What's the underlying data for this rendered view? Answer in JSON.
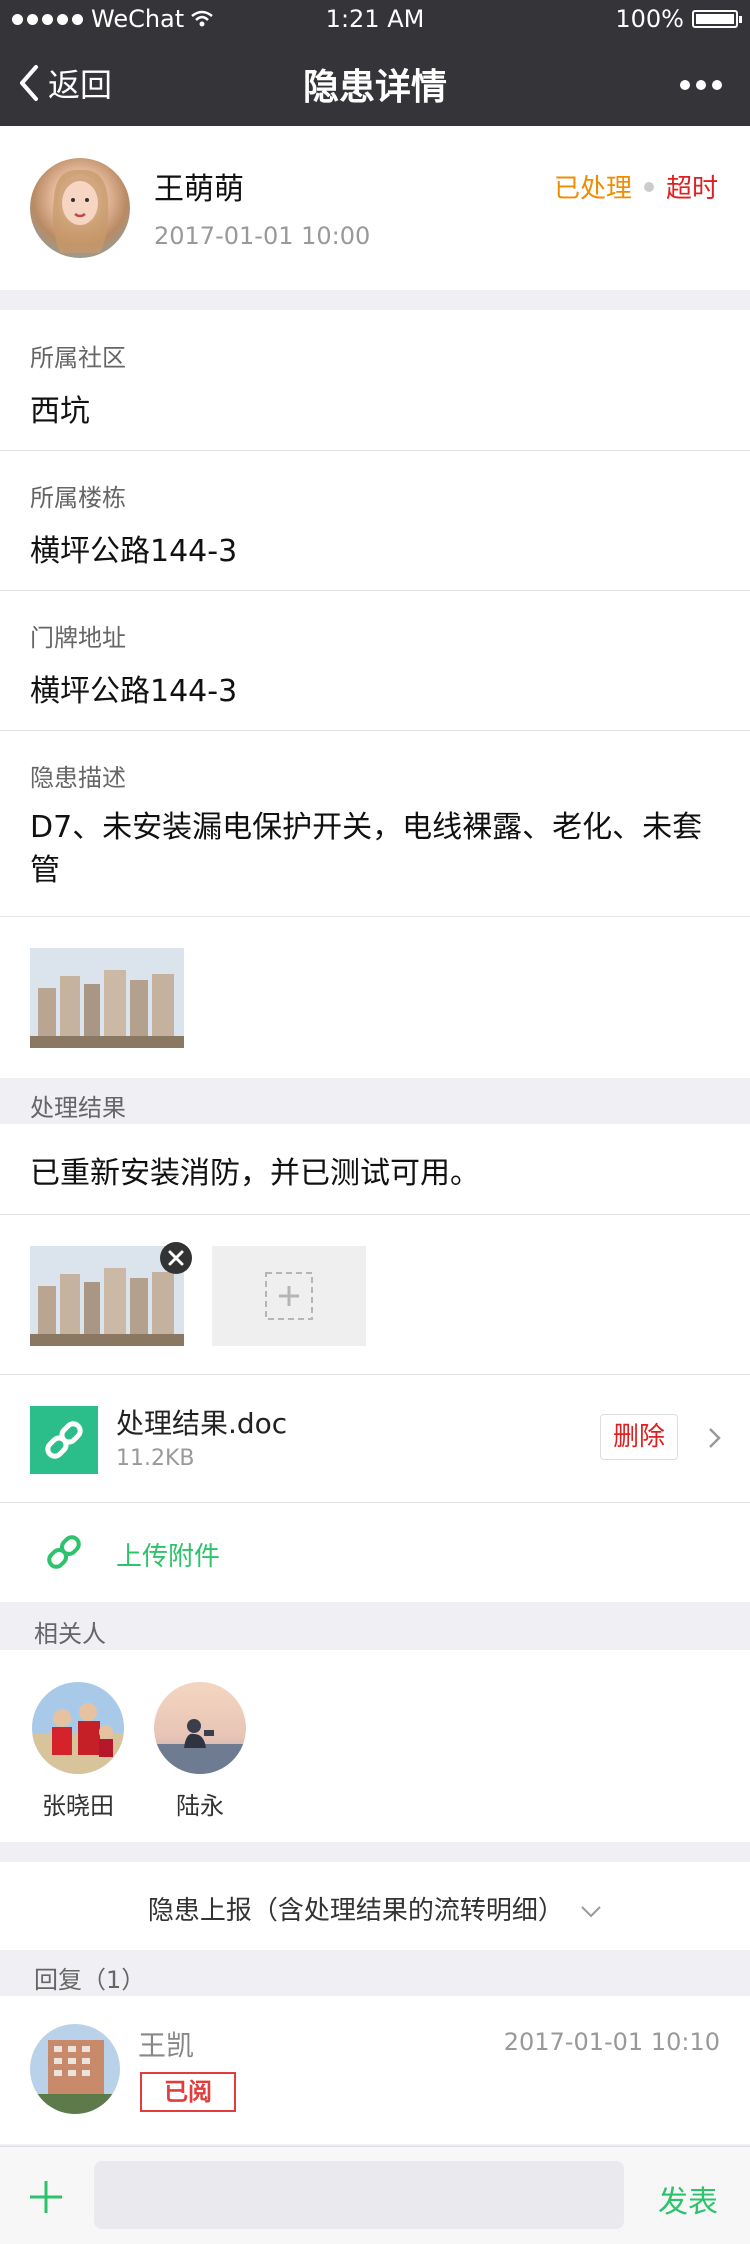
{
  "status_bar": {
    "carrier": "WeChat",
    "time": "1:21 AM",
    "battery": "100%"
  },
  "nav": {
    "back_label": "返回",
    "title": "隐患详情"
  },
  "reporter": {
    "name": "王萌萌",
    "datetime": "2017-01-01 10:00",
    "status_processed": "已处理",
    "status_overtime": "超时",
    "status_processed_color": "#f08c00",
    "status_overtime_color": "#e02020"
  },
  "fields": [
    {
      "label": "所属社区",
      "value": "西坑"
    },
    {
      "label": "所属楼栋",
      "value": "横坪公路144-3"
    },
    {
      "label": "门牌地址",
      "value": "横坪公路144-3"
    },
    {
      "label": "隐患描述",
      "value": "D7、未安装漏电保护开关，电线裸露、老化、未套管"
    }
  ],
  "result": {
    "header": "处理结果",
    "text": "已重新安装消防，并已测试可用。",
    "attachment_name": "处理结果.doc",
    "attachment_size": "11.2KB",
    "delete_label": "删除",
    "upload_label": "上传附件",
    "accent_color": "#2cc36b"
  },
  "related": {
    "header": "相关人",
    "people": [
      {
        "name": "张晓田"
      },
      {
        "name": "陆永"
      }
    ]
  },
  "report_flow": {
    "label": "隐患上报（含处理结果的流转明细）"
  },
  "replies": {
    "header": "回复（1）",
    "items": [
      {
        "name": "王凯",
        "datetime": "2017-01-01 10:10",
        "stamp": "已阅"
      }
    ]
  },
  "input_bar": {
    "send_label": "发表"
  }
}
